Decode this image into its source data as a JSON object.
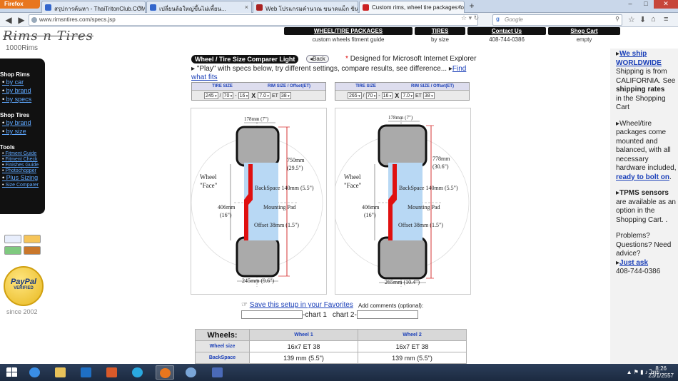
{
  "browser": {
    "firefox_button": "Firefox",
    "tabs": [
      {
        "label": "สรุปการค้นหา - ThaiTritonClub.COM",
        "icon_color": "#3366cc"
      },
      {
        "label": "เปลี่ยนล้อใหญ่ขึ้นไม่เพี้ยน...",
        "icon_color": "#3366cc"
      },
      {
        "label": "Web โปรแกรมคำนวณ ขนาดแม็ก ขนา...",
        "icon_color": "#aa2222"
      },
      {
        "label": "Custom rims, wheel tire packages for ...",
        "icon_color": "#cc2222"
      }
    ],
    "url": "www.rimsntires.com/specs.jsp",
    "search_placeholder": "Google",
    "window_controls": [
      "–",
      "□",
      "✕"
    ]
  },
  "site": {
    "logo_text": "Rims n Tires",
    "logo_sub": "1000Rims",
    "topnav": [
      {
        "label": "WHEEL/TIRE PACKAGES",
        "sub": "custom wheels fitment guide"
      },
      {
        "label": "TIRES",
        "sub": "by size"
      },
      {
        "label": "Contact Us",
        "sub": "408-744-0386"
      },
      {
        "label": "Shop Cart",
        "sub": "empty"
      }
    ]
  },
  "leftbar": {
    "shop_rims": "Shop Rims",
    "rims_links": [
      "by car",
      "by brand",
      "by specs"
    ],
    "shop_tires": "Shop Tires",
    "tires_links": [
      "by brand",
      "by size"
    ],
    "tools": "Tools",
    "tools_links": [
      "Fitment Guide",
      "Fitment Check",
      "Finishes Guide",
      "Photochopper"
    ],
    "tools_links_big": [
      "Plus Sizing"
    ],
    "tools_links_last": [
      "Size Comparer"
    ],
    "paypal": "PayPal",
    "paypal_verified": "VERIFIED",
    "since": "since 2002"
  },
  "main": {
    "title": "Wheel / Tire Size Comparer Light",
    "back": "Back",
    "designed_star": "*",
    "designed": "Designed for Microsoft Internet Explorer",
    "instructions": "\"Play\" with specs below, try different settings, compare results, see difference...",
    "find_what_fits": "Find what fits",
    "spec_headers": [
      "TIRE SIZE",
      "RIM SIZE / Offset(ET)"
    ],
    "tire1": {
      "width": "245",
      "aspect": "70",
      "rim": "16",
      "rim_width": "7.0",
      "et": "38"
    },
    "tire2": {
      "width": "265",
      "aspect": "70",
      "rim": "16",
      "rim_width": "7.0",
      "et": "38"
    },
    "sep_slash": "/",
    "sep_dash": "-",
    "x": "X",
    "et_label": "ET",
    "save_link": "Save this setup in your Favorites",
    "comments_label": "Add comments (optional):",
    "chart1": "-chart 1",
    "chart2": "chart 2-"
  },
  "diagram1": {
    "rim_width": "178mm (7\")",
    "diameter_mm": "750mm",
    "diameter_in": "(29.5\")",
    "wheel": "Wheel",
    "face": "\"Face\"",
    "backspace": "BackSpace 140mm (5.5\")",
    "rim_dia_mm": "406mm",
    "rim_dia_in": "(16\")",
    "mounting": "Mounting Pad",
    "offset": "Offset 38mm (1.5\")",
    "tire_width": "245mm (9.6\")"
  },
  "diagram2": {
    "rim_width": "178mm (7\")",
    "diameter_mm": "778mm",
    "diameter_in": "(30.6\")",
    "wheel": "Wheel",
    "face": "\"Face\"",
    "backspace": "BackSpace 140mm (5.5\")",
    "rim_dia_mm": "406mm",
    "rim_dia_in": "(16\")",
    "mounting": "Mounting Pad",
    "offset": "Offset 38mm (1.5\")",
    "tire_width": "265mm (10.4\")"
  },
  "wheels_table": {
    "head": "Wheels:",
    "col1": "Wheel 1",
    "col2": "Wheel 2",
    "rows": [
      {
        "label": "Wheel size",
        "w1": "16x7 ET 38",
        "w2": "16x7 ET 38"
      },
      {
        "label": "BackSpace",
        "w1": "139 mm (5.5\")",
        "w2": "139 mm (5.5\")"
      }
    ]
  },
  "rightcol": {
    "we_ship": "We ship WORLDWIDE",
    "ship_text": "Shipping is from CALIFORNIA. See",
    "shipping_rates": "shipping rates",
    "in_cart": "in the Shopping Cart",
    "packages_text": "Wheel/tire packages come mounted and balanced, with all necessary hardware included,",
    "ready": "ready to bolt on",
    "tpms": "TPMS sensors",
    "tpms_text": "are available as an option in the Shopping Cart. .",
    "problems": "Problems? Questions? Need advice?",
    "just_ask": "Just ask",
    "phone": "408-744-0386"
  },
  "taskbar": {
    "clock_time": "8:26",
    "clock_date": "23/1/2557",
    "lang": "ไทย"
  }
}
